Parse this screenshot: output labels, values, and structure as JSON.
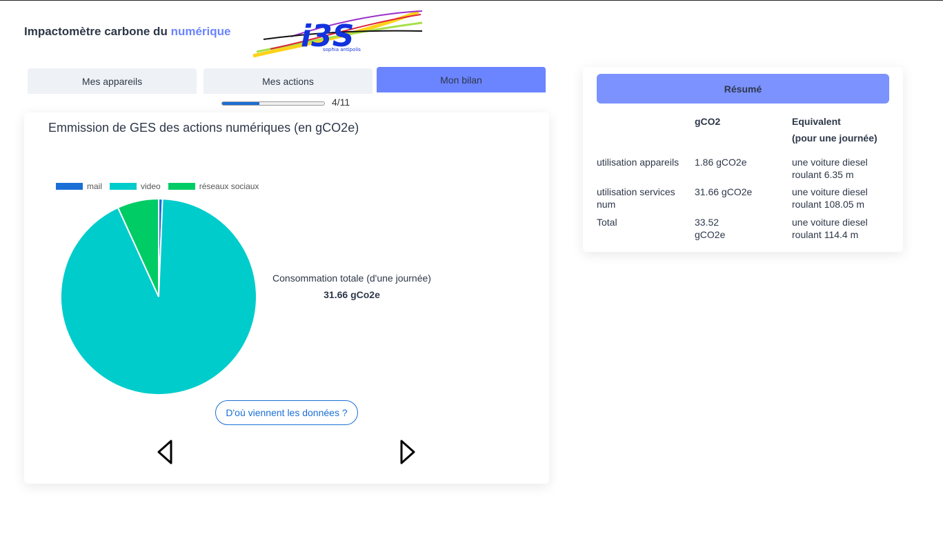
{
  "header": {
    "title_main": "Impactomètre carbone du ",
    "title_accent": "numérique",
    "logo_text": "i3S",
    "logo_subtext": "sophia antipolis"
  },
  "tabs": [
    {
      "label": "Mes appareils",
      "active": false
    },
    {
      "label": "Mes actions",
      "active": false
    },
    {
      "label": "Mon bilan",
      "active": true
    }
  ],
  "progress": {
    "current": 4,
    "total": 11,
    "label": "4/11"
  },
  "emission_card": {
    "title": "Emmission de GES des actions numériques (en gCO2e)",
    "total_label": "Consommation totale (d'une journée)",
    "total_value": "31.66 gCo2e",
    "source_button": "D'où viennent les données ?",
    "prev_icon": "triangle-left-icon",
    "next_icon": "triangle-right-icon"
  },
  "chart_data": {
    "type": "pie",
    "categories": [
      "mail",
      "video",
      "réseaux sociaux"
    ],
    "values": [
      0.2,
      29.3,
      2.16
    ],
    "colors": [
      "#1a6fd6",
      "#00cccc",
      "#00cc66"
    ],
    "legend": "top-left"
  },
  "summary": {
    "button_label": "Résumé",
    "headers": {
      "col2": "gCO2",
      "col3_line1": "Equivalent",
      "col3_line2": "(pour une journée)"
    },
    "rows": [
      {
        "label": "utilisation appareils",
        "gco2": "1.86 gCO2e",
        "equiv": "une voiture diesel roulant 6.35 m"
      },
      {
        "label": "utilisation services num",
        "gco2": "31.66 gCO2e",
        "equiv": "une voiture diesel roulant 108.05 m"
      },
      {
        "label": "Total",
        "gco2": "33.52 gCO2e",
        "equiv": "une voiture diesel roulant 114.4 m"
      }
    ]
  }
}
